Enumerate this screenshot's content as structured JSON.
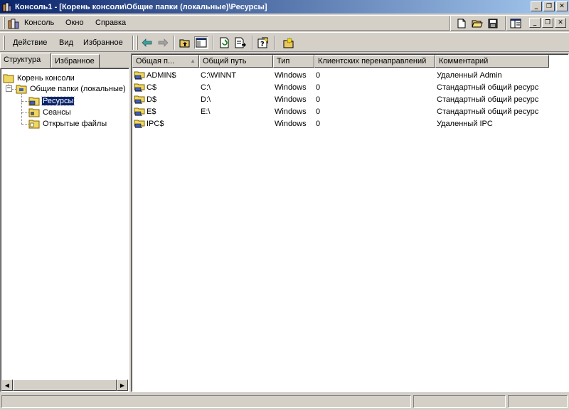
{
  "window": {
    "title": "Консоль1 - [Корень консоли\\Общие папки (локальные)\\Ресурсы]",
    "minimize": "_",
    "restore": "❐",
    "close": "✕"
  },
  "menubar": {
    "items": [
      "Консоль",
      "Окно",
      "Справка"
    ]
  },
  "toolbar": {
    "items": [
      "Действие",
      "Вид",
      "Избранное"
    ]
  },
  "left_tabs": [
    "Структура",
    "Избранное"
  ],
  "tree": {
    "root": "Корень консоли",
    "shared": "Общие папки (локальные)",
    "children": [
      "Ресурсы",
      "Сеансы",
      "Открытые файлы"
    ]
  },
  "table": {
    "columns": [
      "Общая п...",
      "Общий путь",
      "Тип",
      "Клиентских перенаправлений",
      "Комментарий"
    ],
    "rows": [
      [
        "ADMIN$",
        "C:\\WINNT",
        "Windows",
        "0",
        "Удаленный Admin"
      ],
      [
        "C$",
        "C:\\",
        "Windows",
        "0",
        "Стандартный общий ресурс"
      ],
      [
        "D$",
        "D:\\",
        "Windows",
        "0",
        "Стандартный общий ресурс"
      ],
      [
        "E$",
        "E:\\",
        "Windows",
        "0",
        "Стандартный общий ресурс"
      ],
      [
        "IPC$",
        "",
        "Windows",
        "0",
        "Удаленный IPC"
      ]
    ]
  }
}
